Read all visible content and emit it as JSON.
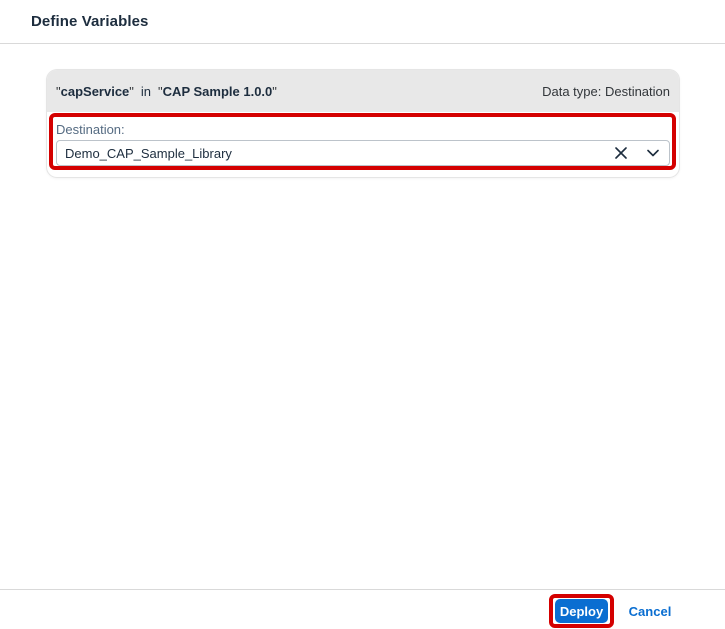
{
  "dialog": {
    "title": "Define Variables"
  },
  "variable": {
    "quote_open_1": "\"",
    "name": "capService",
    "quote_close_1": "\"",
    "in_label": "in",
    "quote_open_2": "\"",
    "package": "CAP Sample 1.0.0",
    "quote_close_2": "\"",
    "data_type": "Data type: Destination"
  },
  "destination": {
    "label": "Destination:",
    "value": "Demo_CAP_Sample_Library",
    "clear_icon": "close-icon",
    "dropdown_icon": "chevron-down-icon"
  },
  "footer": {
    "deploy_label": "Deploy",
    "cancel_label": "Cancel"
  },
  "colors": {
    "accent": "#0a6ed1",
    "highlight": "#d40000",
    "card_header": "#e8e8e8"
  }
}
